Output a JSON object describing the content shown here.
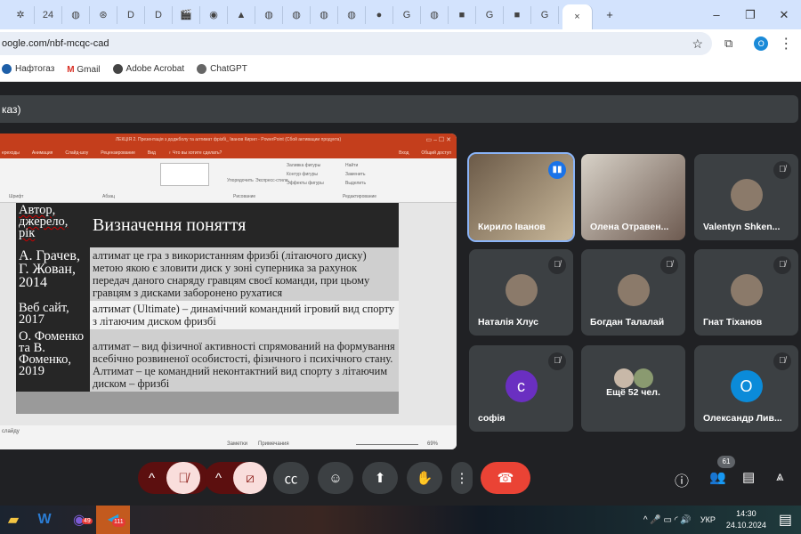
{
  "browser": {
    "tabs": [
      "✲",
      "24",
      "◍",
      "⊛",
      "D",
      "D",
      "🎬",
      "◉",
      "▲",
      "◍",
      "◍",
      "◍",
      "◍",
      "●",
      "G",
      "◍",
      "■",
      "G",
      "■",
      "G"
    ],
    "active_tab_close": "×",
    "new_tab": "+",
    "minimize": "–",
    "maximize": "❐",
    "close": "✕",
    "url": "oogle.com/nbf-mcqc-cad",
    "star": "☆",
    "profile": "О",
    "bookmarks": [
      "Нафтогаз",
      "Gmail",
      "Adobe Acrobat",
      "ChatGPT"
    ]
  },
  "meet": {
    "banner": "каз)",
    "presentation": {
      "title": "ЛЕКЦІЯ 2. Презентація з доджболу та алтимат фрізбі_ Іванов Кирил - PowerPoint (Сбой активации продукта)",
      "tabs": [
        "ереходы",
        "Анимация",
        "Слайд-шоу",
        "Рецензирование",
        "Вид",
        "♀ Что вы хотите сделать?"
      ],
      "signin": "Вход",
      "share": "Общий доступ",
      "ribbon_groups": [
        "Шрифт",
        "Абзац",
        "Рисование",
        "Редактирование"
      ],
      "ribbon_items": [
        "Упорядочить",
        "Экспресс-стили",
        "Заливка фигуры",
        "Контур фигуры",
        "Эффекты фигуры",
        "Найти",
        "Заменить",
        "Выделить"
      ],
      "table": {
        "headers": [
          "Автор, джерело, рік",
          "Визначення поняття"
        ],
        "rows": [
          [
            "А. Грачев, Г. Жован, 2014",
            "алтимат це гра з використанням фризбі (літаючого диску) метою якою є зловити диск у зоні суперника за рахунок передач даного снаряду гравцям своєї команди, при цьому гравцям з дисками заборонено рухатися"
          ],
          [
            "Веб сайт, 2017",
            "алтимат (Ultimate) – динамічний командний ігровий вид спорту з літаючим диском фризбі"
          ],
          [
            "О. Фоменко та В. Фоменко, 2019",
            "алтимат – вид фізичної активності спрямований на формування всебічно розвиненої особистості, фізичного і психічного стану. Алтимат – це командний неконтактний вид спорту з літаючим диском – фризбі"
          ]
        ]
      },
      "status_left": "слайду",
      "notes": "Заметки",
      "comments": "Примечания",
      "zoom": "69%"
    },
    "participants": [
      {
        "name": "Кирило Іванов",
        "speaking": true
      },
      {
        "name": "Олена Отравен..."
      },
      {
        "name": "Valentyn Shken...",
        "muted": true
      },
      {
        "name": "Наталія Хлус",
        "muted": true
      },
      {
        "name": "Богдан Талалай",
        "muted": true
      },
      {
        "name": "Гнат Тіханов",
        "muted": true
      },
      {
        "name": "софія",
        "muted": true,
        "initial": "с",
        "color": "#6a2fc1"
      },
      {
        "name": "Ещё 52 чел."
      },
      {
        "name": "Олександр Лив...",
        "muted": true,
        "initial": "О",
        "color": "#0b8bd9"
      }
    ],
    "people_count": "61",
    "accent": "#8ab4f8",
    "end_call_color": "#ea4335"
  },
  "taskbar": {
    "lang": "УКР",
    "time": "14:30",
    "date": "24.10.2024",
    "viber_badge": "49",
    "telegram_badge": "111"
  }
}
